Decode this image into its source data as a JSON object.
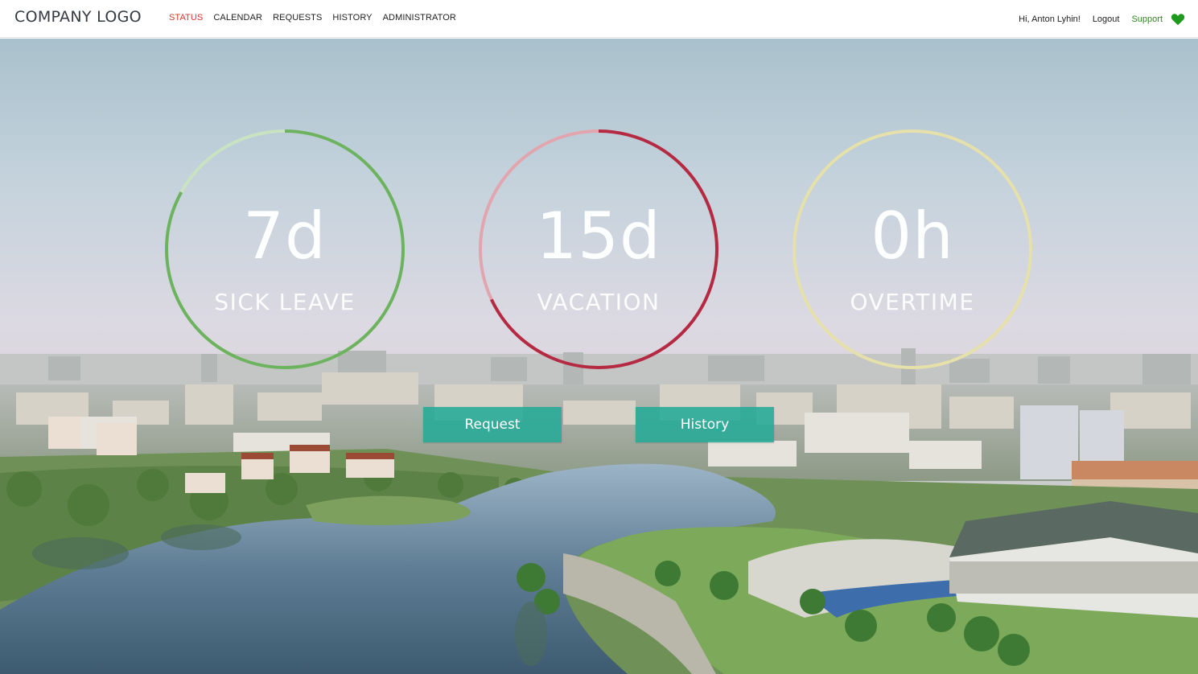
{
  "header": {
    "logo": "COMPANY LOGO",
    "nav": [
      {
        "label": "STATUS",
        "active": true
      },
      {
        "label": "CALENDAR",
        "active": false
      },
      {
        "label": "REQUESTS",
        "active": false
      },
      {
        "label": "HISTORY",
        "active": false
      },
      {
        "label": "ADMINISTRATOR",
        "active": false
      }
    ],
    "greeting": "Hi, Anton Lyhin!",
    "logout_label": "Logout",
    "support_label": "Support",
    "support_icon": "heart-icon",
    "active_color": "#d9362e",
    "support_color": "#2f8a1f"
  },
  "gauges": [
    {
      "value": "7d",
      "label": "SICK LEAVE",
      "color": "#6db35f",
      "track": "#c9e3c1",
      "fraction": 0.83
    },
    {
      "value": "15d",
      "label": "VACATION",
      "color": "#b42a43",
      "track": "#e2a5ae",
      "fraction": 0.68
    },
    {
      "value": "0h",
      "label": "OVERTIME",
      "color": "#e6e0aa",
      "track": "#e6e0aa",
      "fraction": 0.0
    }
  ],
  "actions": {
    "request_label": "Request",
    "history_label": "History",
    "button_color": "#24aa96"
  }
}
